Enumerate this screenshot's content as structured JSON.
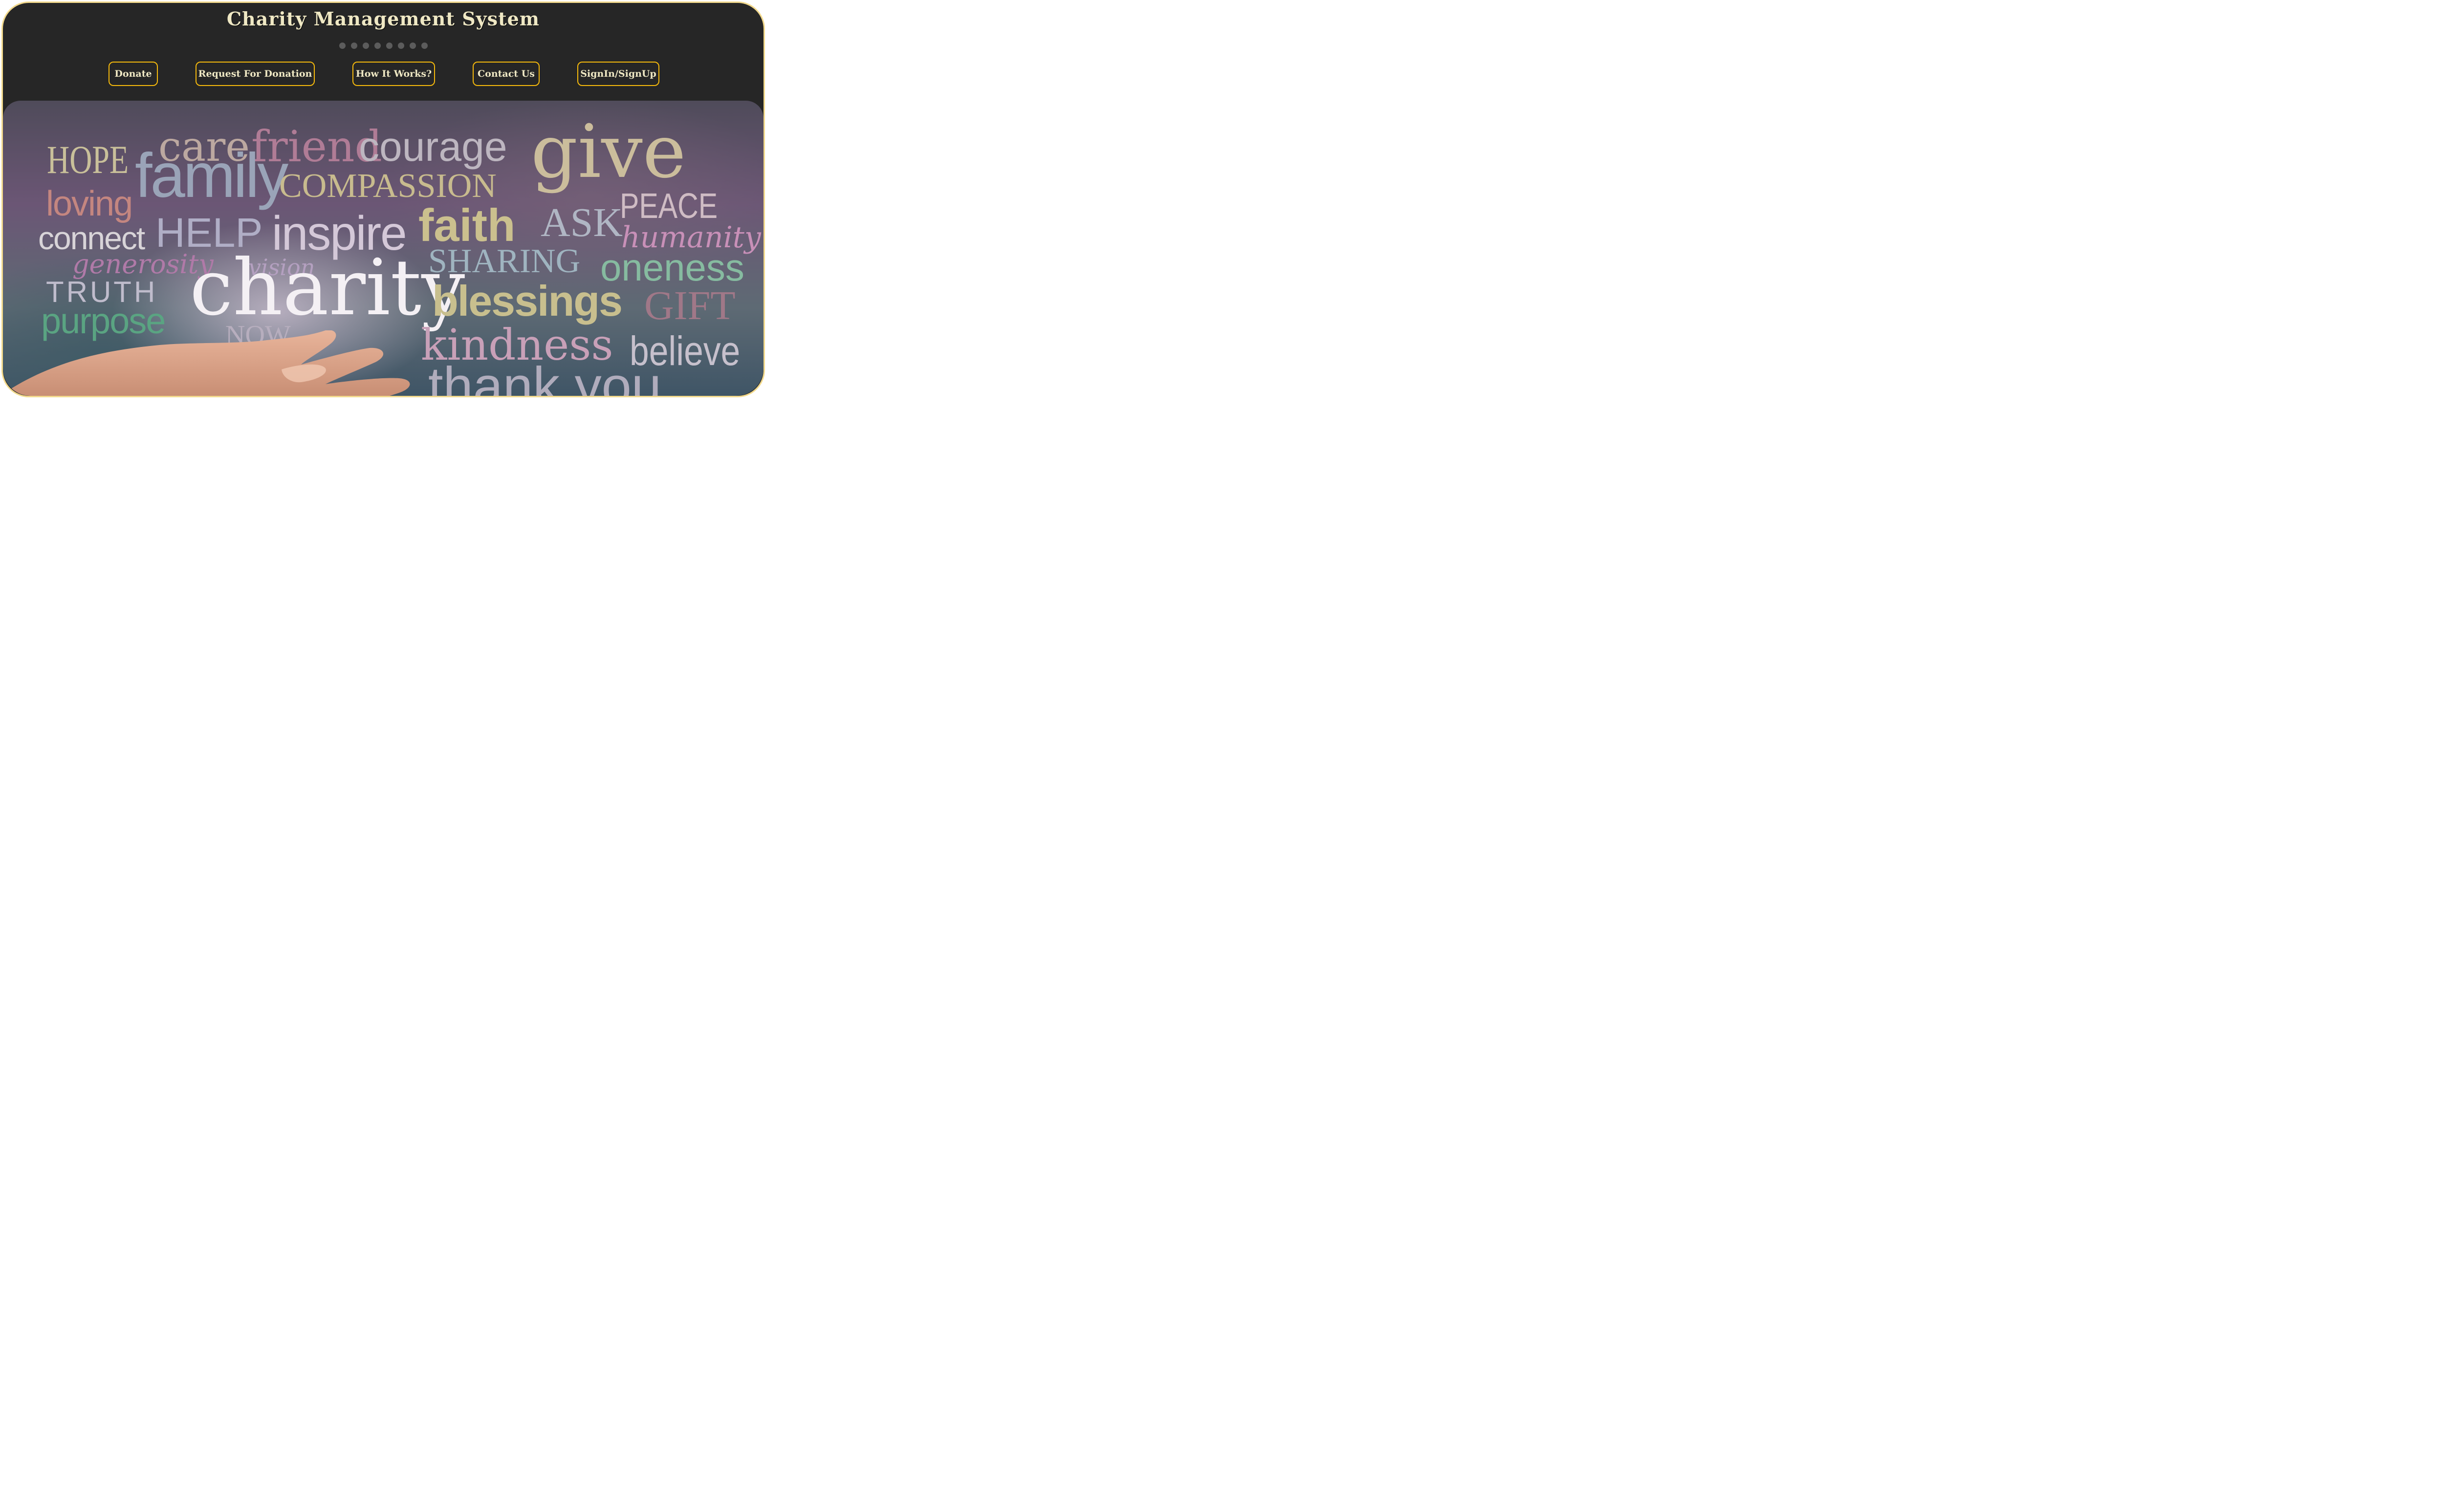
{
  "header": {
    "title": "Charity Management System",
    "carousel_dots": 8
  },
  "nav": {
    "donate": "Donate",
    "request": "Request For Donation",
    "how": "How It Works?",
    "contact": "Contact Us",
    "signin": "SignIn/SignUp"
  },
  "hero": {
    "words": {
      "hope": "HOPE",
      "care": "care",
      "friend": "friend",
      "courage": "courage",
      "give": "give",
      "family": "family",
      "compassion": "COMPASSION",
      "loving": "loving",
      "peace": "PEACE",
      "connect": "connect",
      "help": "HELP",
      "inspire": "inspire",
      "faith": "faith",
      "ask": "ASK",
      "humanity": "humanity",
      "generosity": "generosity",
      "vision": "vision",
      "sharing": "SHARING",
      "oneness": "oneness",
      "truth": "TRUTH",
      "charity": "charity",
      "blessings": "blessings",
      "gift": "GIFT",
      "purpose": "purpose",
      "now": "NOW",
      "kindness": "kindness",
      "believe": "believe",
      "thankyou": "thank you"
    }
  },
  "colors": {
    "frame_border": "#f2d98c",
    "background": "#262626",
    "button_border": "#f5b90c",
    "text": "#efe8c4"
  }
}
